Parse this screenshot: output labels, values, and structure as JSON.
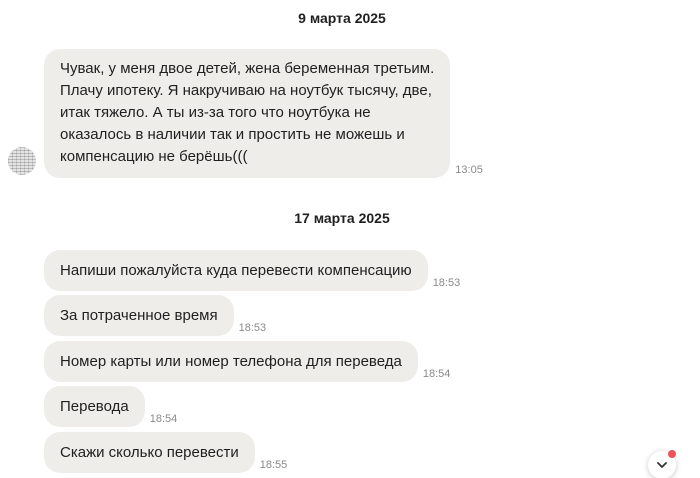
{
  "chat": {
    "groups": [
      {
        "date": "9 марта 2025",
        "messages": [
          {
            "text": "Чувак, у меня двое детей, жена беременная третьим.\nПлачу ипотеку. Я накручиваю на ноутбук тысячу,  две,\nитак тяжело. А ты из-за того что ноутбука не\nоказалось в наличии так и простить не можешь и\nкомпенсацию не берёшь(((",
            "time": "13:05"
          }
        ]
      },
      {
        "date": "17 марта 2025",
        "messages": [
          {
            "text": "Напиши пожалуйста куда перевести компенсацию",
            "time": "18:53"
          },
          {
            "text": "За потраченное время",
            "time": "18:53"
          },
          {
            "text": "Номер карты или номер телефона для переведа",
            "time": "18:54"
          },
          {
            "text": "Перевода",
            "time": "18:54"
          },
          {
            "text": "Скажи сколько перевести",
            "time": "18:55"
          }
        ]
      }
    ]
  },
  "icons": {
    "scroll_down": "chevron-down-icon",
    "notification": "notification-dot"
  },
  "colors": {
    "bubble": "#efedea",
    "time": "#8a8a8a",
    "notification_dot": "#f0505a"
  }
}
